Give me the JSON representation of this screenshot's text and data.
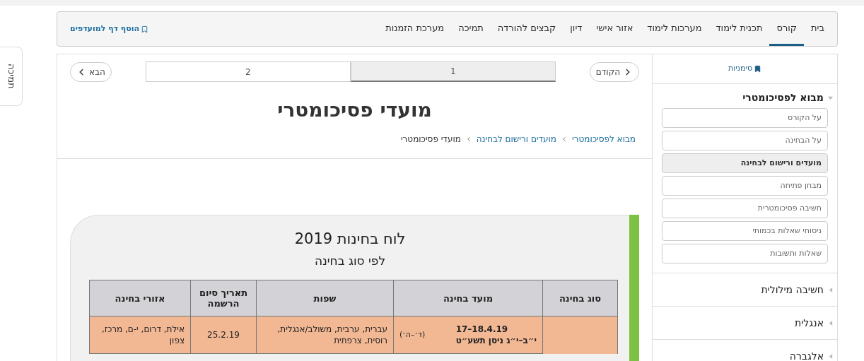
{
  "side_tab": {
    "label": "תמיכה"
  },
  "nav": {
    "tabs": [
      {
        "label": "בית",
        "selected": false
      },
      {
        "label": "קורס",
        "selected": true
      },
      {
        "label": "תכנית לימוד",
        "selected": false
      },
      {
        "label": "מערכות לימוד",
        "selected": false
      },
      {
        "label": "אזור אישי",
        "selected": false
      },
      {
        "label": "דיון",
        "selected": false
      },
      {
        "label": "קבצים להורדה",
        "selected": false
      },
      {
        "label": "תמיכה",
        "selected": false
      },
      {
        "label": "מערכת הזמנות",
        "selected": false
      }
    ],
    "bookmark_link": "הוסף דף למועדפים"
  },
  "sidebar": {
    "header": "סימניות",
    "sections": [
      {
        "title": "מבוא לפסיכומטרי",
        "expanded": true,
        "items": [
          {
            "label": "על הקורס",
            "selected": false
          },
          {
            "label": "על הבחינה",
            "selected": false
          },
          {
            "label": "מועדים ורישום לבחינה",
            "selected": true
          },
          {
            "label": "מבחן פתיחה",
            "selected": false
          },
          {
            "label": "חשיבה פסיכומטרית",
            "selected": false
          },
          {
            "label": "ניסוחי שאלות בכמותי",
            "selected": false
          },
          {
            "label": "שאלות ותשובות",
            "selected": false
          }
        ]
      },
      {
        "title": "חשיבה מילולית",
        "expanded": false
      },
      {
        "title": "אנגלית",
        "expanded": false
      },
      {
        "title": "אלגברה",
        "expanded": false
      }
    ]
  },
  "pager": {
    "prev": "הקודם",
    "next": "הבא",
    "pages": [
      {
        "label": "1",
        "selected": true
      },
      {
        "label": "2",
        "selected": false
      }
    ]
  },
  "title": "מועדי פסיכומטרי",
  "breadcrumb": [
    {
      "label": "מבוא לפסיכומטרי",
      "link": true
    },
    {
      "label": "מועדים ורישום לבחינה",
      "link": true
    },
    {
      "label": "מועדי פסיכומטרי",
      "link": false
    }
  ],
  "schedule": {
    "title": "לוח בחינות 2019",
    "subtitle": "לפי סוג בחינה",
    "columns": [
      "סוג בחינה",
      "מועד בחינה",
      "שפות",
      "תאריך סיום הרשמה",
      "אזורי בחינה"
    ],
    "rows": [
      {
        "date": "17–18.4.19",
        "hebrew_date": "י״ב–י״ג ניסן תשע״ט",
        "days": "(ד׳–ה׳)",
        "languages": "עברית, ערבית, משולב/אנגלית, רוסית, צרפתית",
        "deadline": "25.2.19",
        "regions": "אילת, דרום, י-ם, מרכז, צפון"
      }
    ]
  }
}
